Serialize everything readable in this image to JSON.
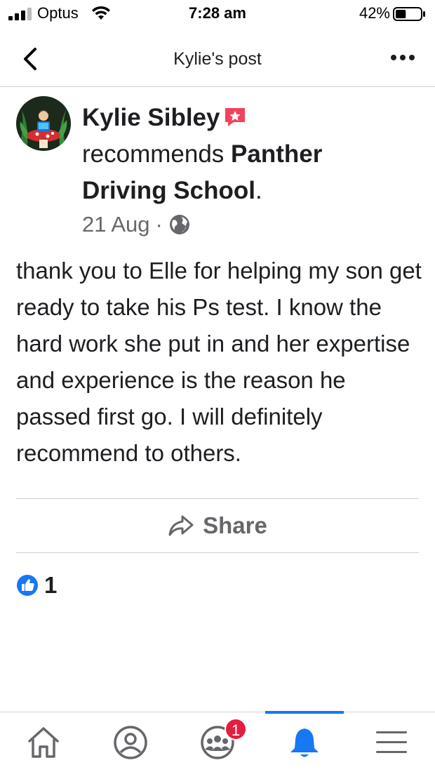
{
  "status_bar": {
    "carrier": "Optus",
    "time": "7:28 am",
    "battery": "42%",
    "battery_level": 0.42
  },
  "header": {
    "title": "Kylie's post"
  },
  "post": {
    "author": "Kylie Sibley",
    "verb": "recommends",
    "page_name": "Panther Driving School",
    "period": ".",
    "date": "21 Aug",
    "separator": "·",
    "body": "thank you to Elle for helping my son get ready to take his Ps test. I know the hard work she put in and her expertise and experience is the reason he passed first go. I will definitely recommend to others."
  },
  "actions": {
    "share_label": "Share"
  },
  "reactions": {
    "like_count": "1"
  },
  "bottom_nav": {
    "items": [
      "home-icon",
      "profile-icon",
      "groups-icon",
      "notifications-icon",
      "menu-icon"
    ],
    "groups_badge": "1",
    "active_color": "#1877f2"
  },
  "colors": {
    "accent": "#1877f2",
    "badge_red": "#e41e3f",
    "recommend_pink": "#f3425f"
  }
}
